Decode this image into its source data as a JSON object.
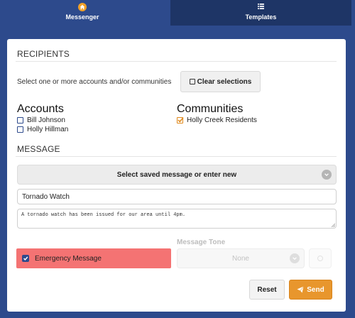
{
  "tabs": [
    {
      "label": "Messenger",
      "icon": "home-icon",
      "active": true
    },
    {
      "label": "Templates",
      "icon": "list-icon",
      "active": false
    }
  ],
  "recipients": {
    "title": "RECIPIENTS",
    "helper": "Select one or more accounts and/or communities",
    "clear_label": "Clear selections",
    "accounts_title": "Accounts",
    "accounts": [
      {
        "label": "Bill Johnson",
        "checked": false
      },
      {
        "label": "Holly Hillman",
        "checked": false
      }
    ],
    "communities_title": "Communities",
    "communities": [
      {
        "label": "Holly Creek Residents",
        "checked": true
      }
    ]
  },
  "message": {
    "title": "MESSAGE",
    "saved_select_label": "Select saved message or enter new",
    "title_value": "Tornado Watch",
    "body_value": "A tornado watch has been issued for our area until 4pm.",
    "emergency_label": "Emergency Message",
    "emergency_checked": true,
    "tone_label": "Message Tone",
    "tone_value": "None"
  },
  "actions": {
    "reset_label": "Reset",
    "send_label": "Send"
  },
  "colors": {
    "background": "#2d4a8c",
    "accent": "#e8962d",
    "emergency": "#f47373"
  }
}
